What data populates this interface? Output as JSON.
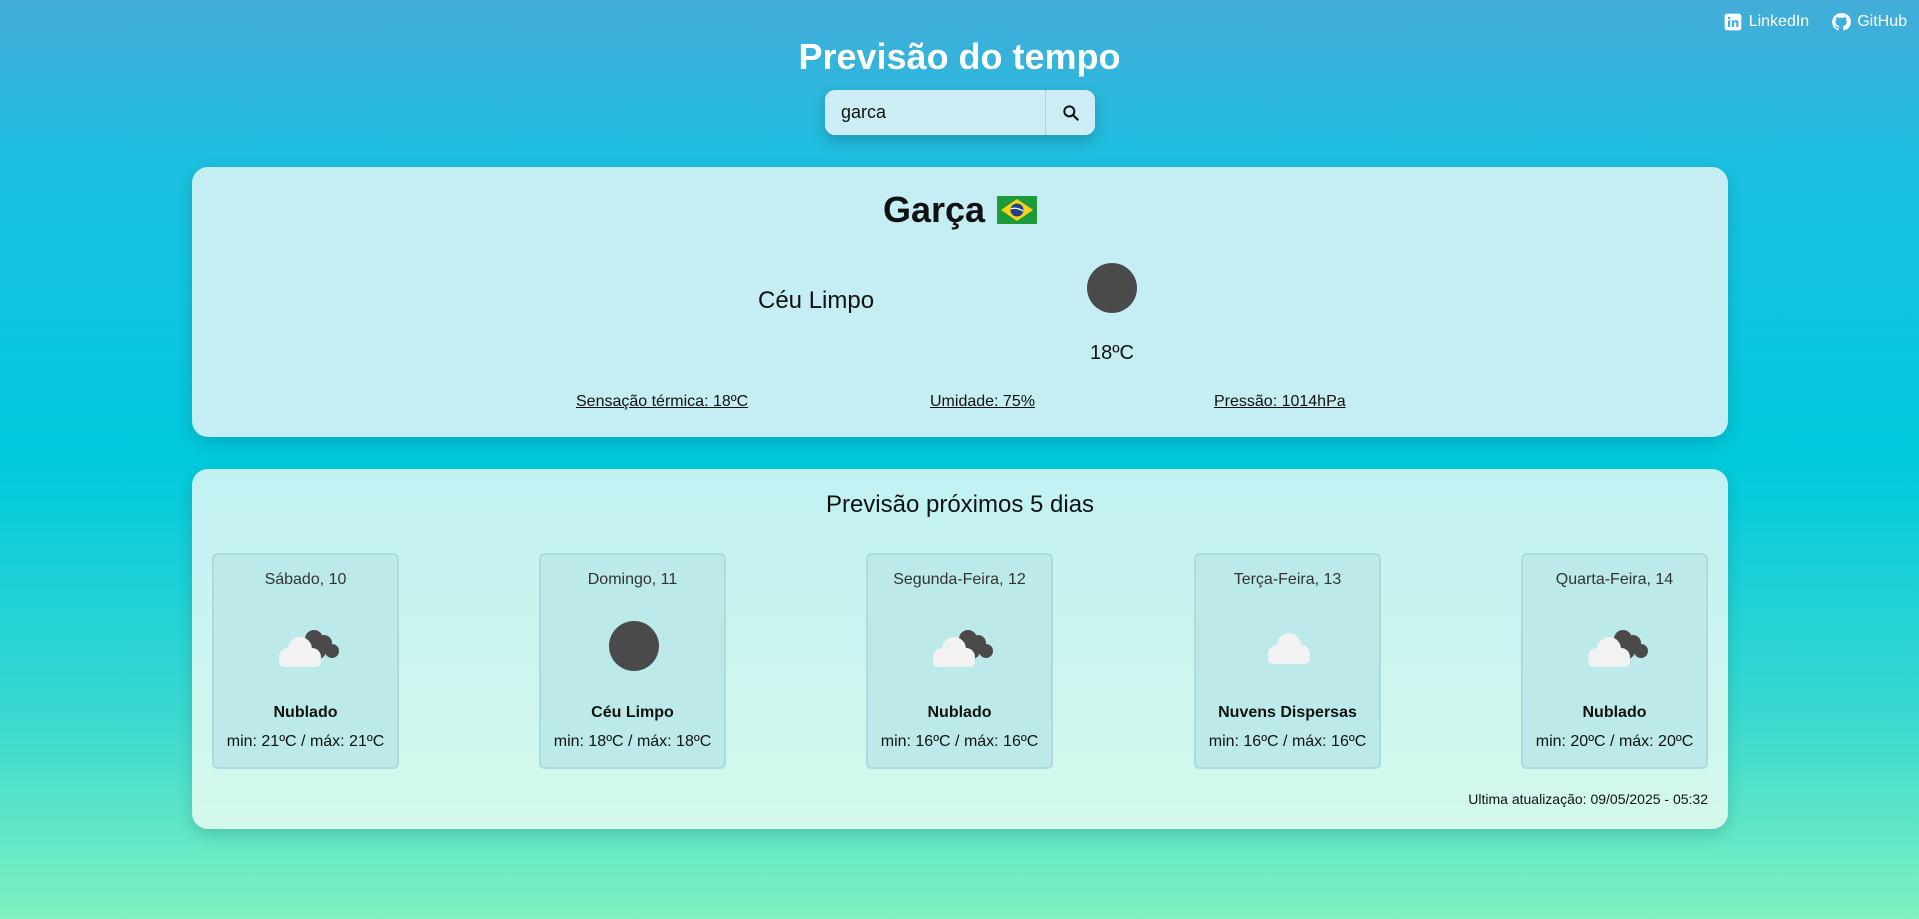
{
  "social": {
    "linkedin_label": "LinkedIn",
    "github_label": "GitHub"
  },
  "header": {
    "title": "Previsão do tempo"
  },
  "search": {
    "value": "garca",
    "button_icon": "search-icon"
  },
  "current": {
    "city": "Garça",
    "flag_icon": "brazil-flag-icon",
    "description": "Céu Limpo",
    "weather_icon": "clear-sky-icon",
    "temperature": "18ºC",
    "feels_like": "Sensação térmica: 18ºC",
    "humidity": "Umidade: 75%",
    "pressure": "Pressão: 1014hPa"
  },
  "forecast": {
    "title": "Previsão próximos 5 dias",
    "days": [
      {
        "label": "Sábado, 10",
        "icon": "cloudy-icon",
        "description": "Nublado",
        "temps": "min: 21ºC / máx: 21ºC"
      },
      {
        "label": "Domingo, 11",
        "icon": "clear-sky-icon",
        "description": "Céu Limpo",
        "temps": "min: 18ºC / máx: 18ºC"
      },
      {
        "label": "Segunda-Feira, 12",
        "icon": "cloudy-icon",
        "description": "Nublado",
        "temps": "min: 16ºC / máx: 16ºC"
      },
      {
        "label": "Terça-Feira, 13",
        "icon": "scattered-clouds-icon",
        "description": "Nuvens Dispersas",
        "temps": "min: 16ºC / máx: 16ºC"
      },
      {
        "label": "Quarta-Feira, 14",
        "icon": "cloudy-icon",
        "description": "Nublado",
        "temps": "min: 20ºC / máx: 20ºC"
      }
    ],
    "last_updated": "Ultima atualização: 09/05/2025 - 05:32"
  },
  "colors": {
    "background_top": "#45acd9",
    "background_bottom": "#7ff0c0",
    "card": "#c4eef3",
    "icon_dark": "#4a4a4a",
    "cloud_light": "#f2f2f2"
  }
}
